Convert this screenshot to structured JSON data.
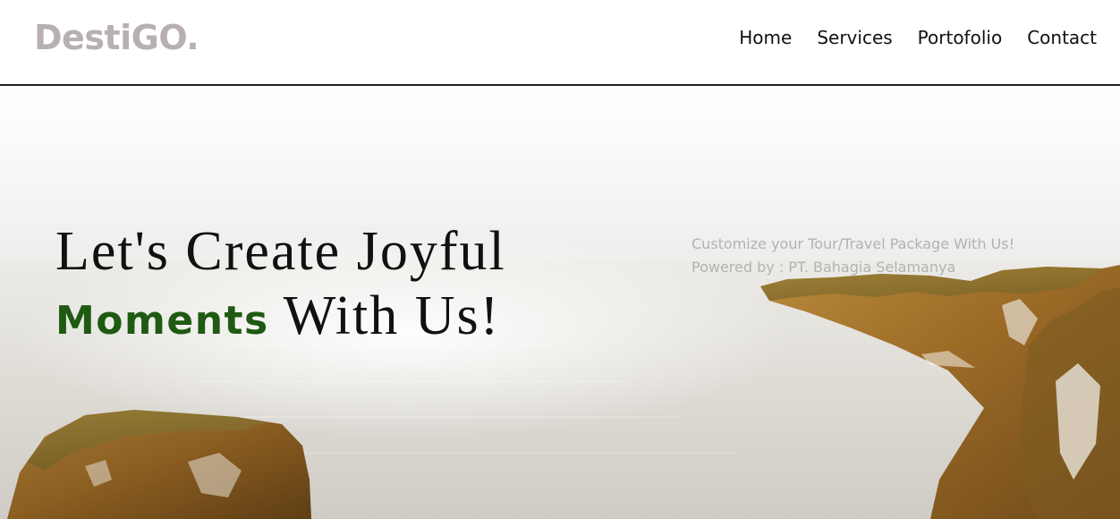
{
  "brand": {
    "name": "DestiGO."
  },
  "nav": {
    "items": [
      "Home",
      "Services",
      "Portofolio",
      "Contact"
    ]
  },
  "hero": {
    "headline_line1": "Let's Create Joyful",
    "headline_accent": "Moments",
    "headline_rest": "With Us!",
    "tagline_line1": "Customize your Tour/Travel Package With Us!",
    "tagline_line2": "Powered by : PT. Bahagia Selamanya"
  },
  "colors": {
    "accent": "#1e5a11",
    "logo": "#b8b0b0",
    "tagline": "#b2b2b2",
    "nav_text": "#111111"
  }
}
